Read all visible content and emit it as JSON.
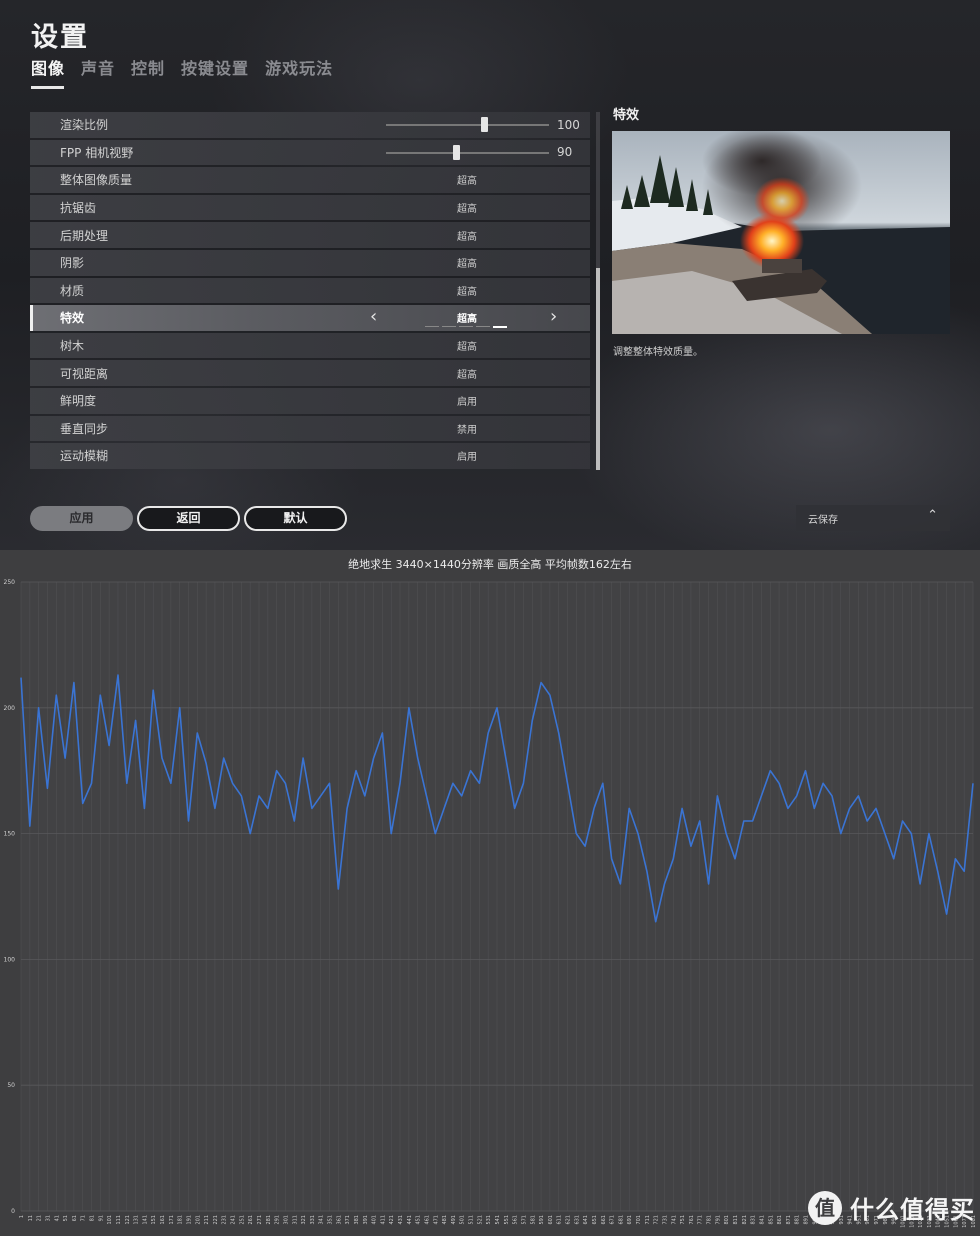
{
  "settings": {
    "title": "设置",
    "tabs": [
      {
        "label": "图像",
        "active": true
      },
      {
        "label": "声音",
        "active": false
      },
      {
        "label": "控制",
        "active": false
      },
      {
        "label": "按键设置",
        "active": false
      },
      {
        "label": "游戏玩法",
        "active": false
      }
    ],
    "sliders": [
      {
        "label": "渲染比例",
        "value": "100",
        "fraction": 0.6
      },
      {
        "label": "FPP 相机视野",
        "value": "90",
        "fraction": 0.43
      }
    ],
    "options": [
      {
        "label": "整体图像质量",
        "value": "超高"
      },
      {
        "label": "抗锯齿",
        "value": "超高"
      },
      {
        "label": "后期处理",
        "value": "超高"
      },
      {
        "label": "阴影",
        "value": "超高"
      },
      {
        "label": "材质",
        "value": "超高"
      },
      {
        "label": "特效",
        "value": "超高",
        "selected": true,
        "level_index": 4,
        "level_count": 5
      },
      {
        "label": "树木",
        "value": "超高"
      },
      {
        "label": "可视距离",
        "value": "超高"
      },
      {
        "label": "鲜明度",
        "value": "启用"
      },
      {
        "label": "垂直同步",
        "value": "禁用"
      },
      {
        "label": "运动模糊",
        "value": "启用"
      }
    ],
    "preview": {
      "title": "特效",
      "description": "调整整体特效质量。"
    },
    "buttons": {
      "apply": "应用",
      "back": "返回",
      "default": "默认"
    },
    "cloud_save": {
      "label": "云保存",
      "icon": "chevron-up-icon"
    },
    "icons": {
      "left": "chevron-left-icon",
      "right": "chevron-right-icon"
    }
  },
  "chart_data": {
    "type": "line",
    "title": "绝地求生 3440×1440分辨率 画质全高 平均帧数162左右",
    "xlabel": "",
    "ylabel": "",
    "ylim": [
      0,
      250
    ],
    "yticks": [
      0,
      50,
      100,
      150,
      200,
      250
    ],
    "grid": true,
    "color": "#3a74d4",
    "x_start": 1,
    "x_step": 10,
    "x_count": 109,
    "x_max": 1091,
    "series": [
      {
        "values": [
          212,
          153,
          200,
          168,
          205,
          180,
          210,
          162,
          170,
          205,
          185,
          213,
          170,
          195,
          160,
          207,
          180,
          170,
          200,
          155,
          190,
          178,
          160,
          180,
          170,
          165,
          150,
          165,
          160,
          175,
          170,
          155,
          180,
          160,
          165,
          170,
          128,
          160,
          175,
          165,
          180,
          190,
          150,
          170,
          200,
          180,
          165,
          150,
          160,
          170,
          165,
          175,
          170,
          190,
          200,
          180,
          160,
          170,
          195,
          210,
          205,
          190,
          170,
          150,
          145,
          160,
          170,
          140,
          130,
          160,
          150,
          135,
          115,
          130,
          140,
          160,
          145,
          155,
          130,
          165,
          150,
          140,
          155,
          155,
          165,
          175,
          170,
          160,
          165,
          175,
          160,
          170,
          165,
          150,
          160,
          165,
          155,
          160,
          150,
          140,
          155,
          150,
          130,
          150,
          135,
          118,
          140,
          135,
          170
        ]
      }
    ]
  },
  "watermark": {
    "logo_char": "值",
    "text": "什么值得买"
  }
}
